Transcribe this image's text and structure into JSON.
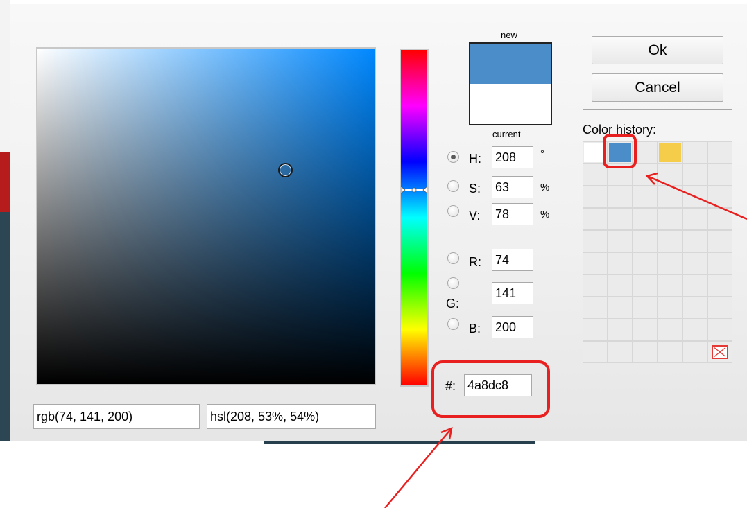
{
  "preview": {
    "new_label": "new",
    "current_label": "current",
    "new_color": "#4a8dc8",
    "current_color": "#ffffff"
  },
  "hsv": {
    "h_label": "H:",
    "h_value": "208",
    "h_unit": "°",
    "s_label": "S:",
    "s_value": "63",
    "s_unit": "%",
    "v_label": "V:",
    "v_value": "78",
    "v_unit": "%",
    "selected": "H"
  },
  "rgb": {
    "r_label": "R:",
    "r_value": "74",
    "g_label": "G:",
    "g_value": "141",
    "b_label": "B:",
    "b_value": "200"
  },
  "hex": {
    "label": "#:",
    "value": "4a8dc8"
  },
  "buttons": {
    "ok": "Ok",
    "cancel": "Cancel"
  },
  "history": {
    "label": "Color history:",
    "swatches": [
      "#ffffff",
      "#4a8dc8",
      "",
      "#f5cd4b"
    ],
    "delete_icon": "delete-icon"
  },
  "outputs": {
    "rgb": "rgb(74, 141, 200)",
    "hsl": "hsl(208, 53%, 54%)"
  },
  "annotations": {
    "color": "#e8201f"
  }
}
